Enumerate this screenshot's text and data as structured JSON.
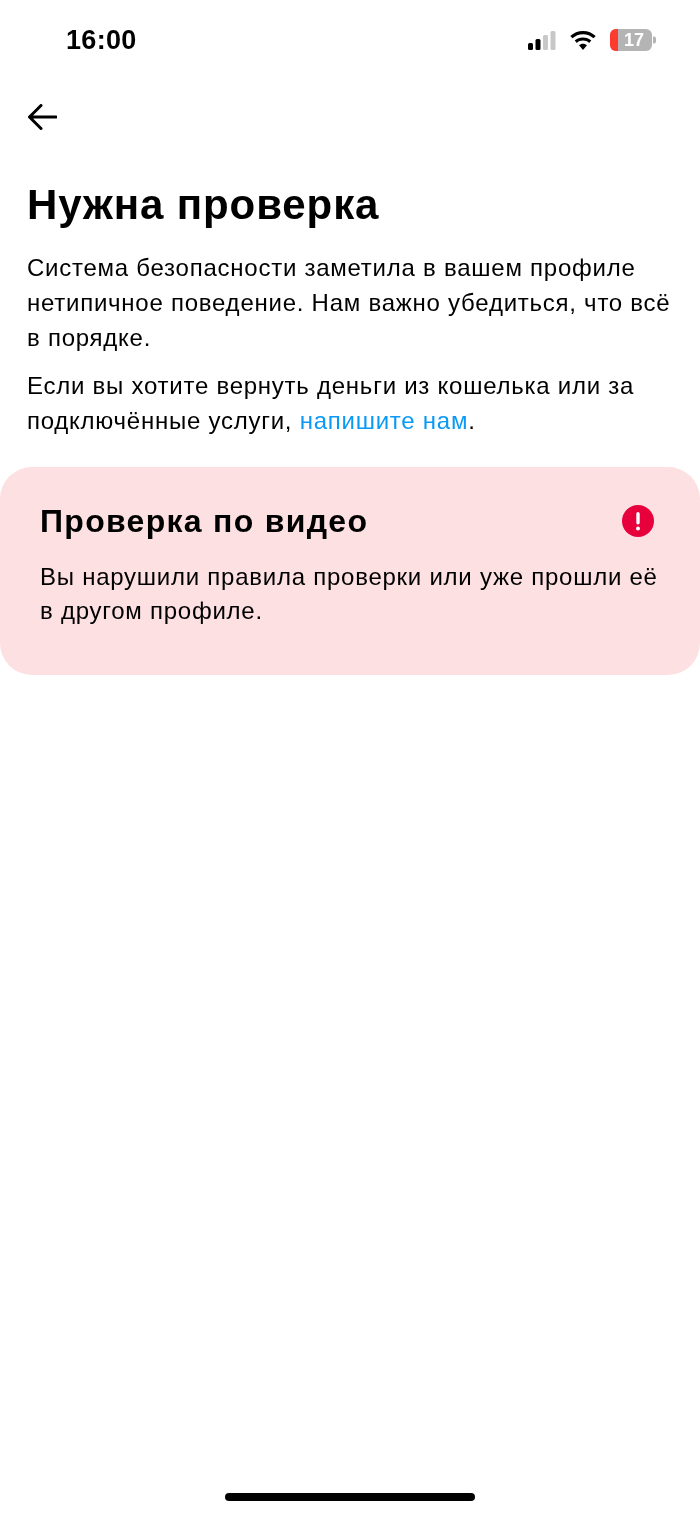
{
  "status_bar": {
    "time": "16:00",
    "battery": "17"
  },
  "title": "Нужна проверка",
  "paragraphs": [
    {
      "kind": "plain",
      "text": "Система безопасности заметила в вашем профиле нетипичное поведение. Нам важно убедиться, что всё в порядке."
    },
    {
      "kind": "with_link",
      "text": "Если вы хотите вернуть деньги из кошелька или за подключённые услуги, ",
      "link": "напишите нам",
      "after": "."
    }
  ],
  "card": {
    "kind": "error",
    "title": "Проверка по видео",
    "text": "Вы нарушили правила проверки или уже прошли её в другом профиле."
  }
}
